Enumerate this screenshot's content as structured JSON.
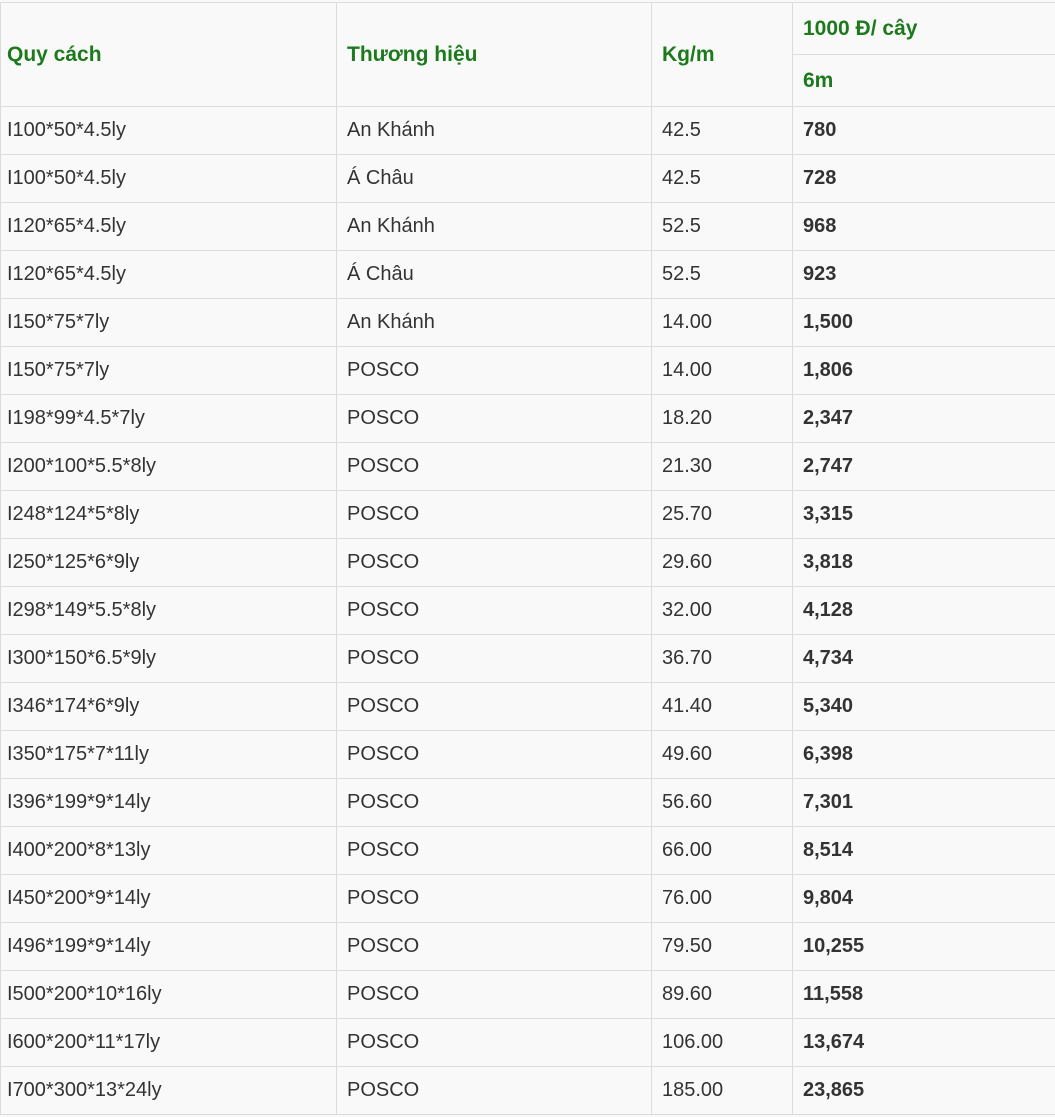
{
  "header": {
    "spec": "Quy cách",
    "brand": "Thương hiệu",
    "weight": "Kg/m",
    "price_group": "1000 Đ/ cây",
    "length": "6m"
  },
  "rows": [
    {
      "spec": "I100*50*4.5ly",
      "brand": "An Khánh",
      "weight": "42.5",
      "price": "780"
    },
    {
      "spec": "I100*50*4.5ly",
      "brand": "Á Châu",
      "weight": "42.5",
      "price": "728"
    },
    {
      "spec": "I120*65*4.5ly",
      "brand": "An Khánh",
      "weight": "52.5",
      "price": "968"
    },
    {
      "spec": "I120*65*4.5ly",
      "brand": "Á Châu",
      "weight": "52.5",
      "price": "923"
    },
    {
      "spec": "I150*75*7ly",
      "brand": "An Khánh",
      "weight": "14.00",
      "price": "1,500"
    },
    {
      "spec": "I150*75*7ly",
      "brand": "POSCO",
      "weight": "14.00",
      "price": "1,806"
    },
    {
      "spec": "I198*99*4.5*7ly",
      "brand": "POSCO",
      "weight": "18.20",
      "price": "2,347"
    },
    {
      "spec": "I200*100*5.5*8ly",
      "brand": "POSCO",
      "weight": "21.30",
      "price": "2,747"
    },
    {
      "spec": "I248*124*5*8ly",
      "brand": "POSCO",
      "weight": "25.70",
      "price": "3,315"
    },
    {
      "spec": "I250*125*6*9ly",
      "brand": "POSCO",
      "weight": "29.60",
      "price": "3,818"
    },
    {
      "spec": "I298*149*5.5*8ly",
      "brand": "POSCO",
      "weight": "32.00",
      "price": "4,128"
    },
    {
      "spec": "I300*150*6.5*9ly",
      "brand": "POSCO",
      "weight": "36.70",
      "price": "4,734"
    },
    {
      "spec": "I346*174*6*9ly",
      "brand": "POSCO",
      "weight": "41.40",
      "price": "5,340"
    },
    {
      "spec": "I350*175*7*11ly",
      "brand": "POSCO",
      "weight": "49.60",
      "price": "6,398"
    },
    {
      "spec": "I396*199*9*14ly",
      "brand": "POSCO",
      "weight": "56.60",
      "price": "7,301"
    },
    {
      "spec": "I400*200*8*13ly",
      "brand": "POSCO",
      "weight": "66.00",
      "price": "8,514"
    },
    {
      "spec": "I450*200*9*14ly",
      "brand": "POSCO",
      "weight": "76.00",
      "price": "9,804"
    },
    {
      "spec": "I496*199*9*14ly",
      "brand": "POSCO",
      "weight": "79.50",
      "price": "10,255"
    },
    {
      "spec": "I500*200*10*16ly",
      "brand": "POSCO",
      "weight": "89.60",
      "price": "11,558"
    },
    {
      "spec": "I600*200*11*17ly",
      "brand": "POSCO",
      "weight": "106.00",
      "price": "13,674"
    },
    {
      "spec": "I700*300*13*24ly",
      "brand": "POSCO",
      "weight": "185.00",
      "price": "23,865"
    }
  ],
  "colors": {
    "header_text": "#1c7a1c",
    "body_text": "#333333",
    "border": "#dcdcdc",
    "background": "#f9f9f9"
  }
}
